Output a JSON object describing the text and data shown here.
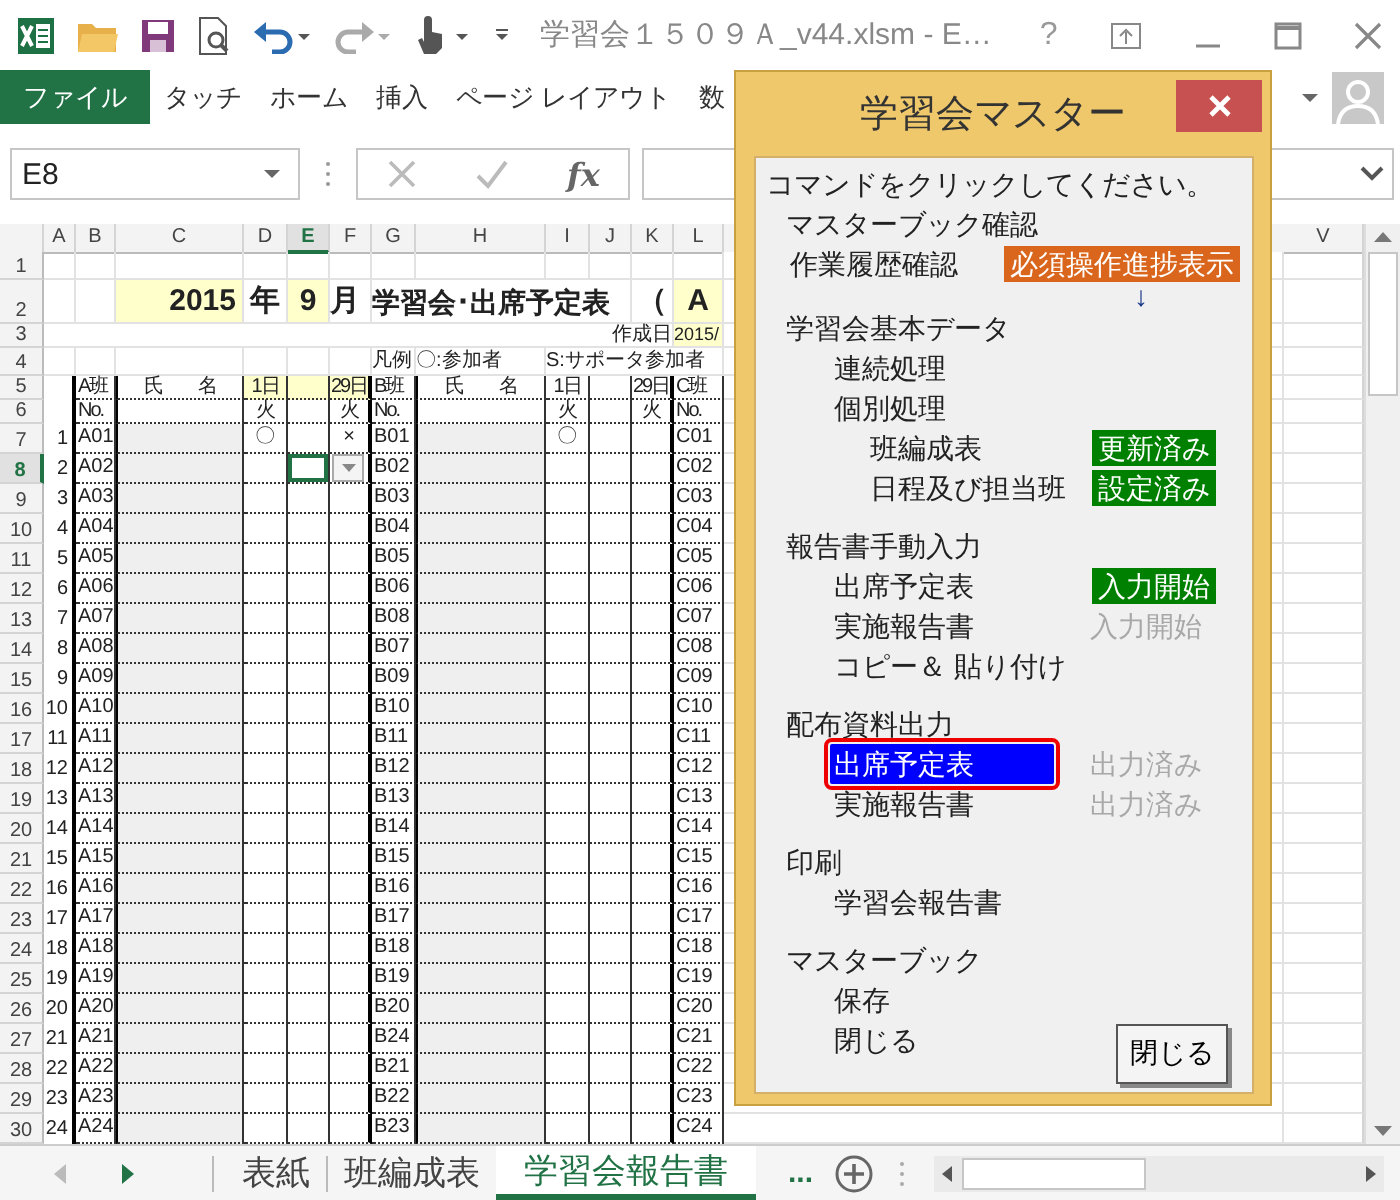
{
  "window": {
    "title": "学習会１５０９Ａ_v44.xlsm - E…",
    "help": "?"
  },
  "ribbon": {
    "tabs": [
      {
        "label": "ファイル",
        "kind": "file",
        "selected": false
      },
      {
        "label": "タッチ",
        "kind": "tab",
        "selected": false
      },
      {
        "label": "ホーム",
        "kind": "tab",
        "selected": false
      },
      {
        "label": "挿入",
        "kind": "tab",
        "selected": false
      },
      {
        "label": "ページ レイアウト",
        "kind": "tab",
        "selected": false
      },
      {
        "label": "数",
        "kind": "tab",
        "selected": false
      }
    ]
  },
  "formula_bar": {
    "name_box": "E8",
    "function_label": "fx"
  },
  "sheet": {
    "columns": [
      {
        "label": "A",
        "selected": false
      },
      {
        "label": "B",
        "selected": false
      },
      {
        "label": "C",
        "selected": false
      },
      {
        "label": "D",
        "selected": false
      },
      {
        "label": "E",
        "selected": true
      },
      {
        "label": "F",
        "selected": false
      },
      {
        "label": "G",
        "selected": false
      },
      {
        "label": "H",
        "selected": false
      },
      {
        "label": "I",
        "selected": false
      },
      {
        "label": "J",
        "selected": false
      },
      {
        "label": "K",
        "selected": false
      },
      {
        "label": "L",
        "selected": false
      },
      {
        "label": "V",
        "selected": false
      }
    ],
    "rows": [
      {
        "number": "1",
        "kind": "blank",
        "selected": false
      },
      {
        "number": "2",
        "kind": "title",
        "selected": false,
        "cells": [
          null,
          null,
          {
            "text": "2015",
            "highlight": true
          },
          {
            "text": "年"
          },
          {
            "text": "9",
            "highlight": true
          },
          {
            "text": "月"
          },
          {
            "text": "学習会･出席予定表"
          },
          null,
          null,
          null,
          {
            "text": "（"
          },
          {
            "text": "A",
            "highlight": true
          }
        ]
      },
      {
        "number": "3",
        "kind": "small",
        "selected": false,
        "cells": [
          null,
          null,
          null,
          null,
          null,
          null,
          null,
          null,
          null,
          null,
          {
            "text": "作成日"
          },
          {
            "text": "2015/",
            "highlight": true
          }
        ]
      },
      {
        "number": "4",
        "kind": "note",
        "selected": false,
        "cells": [
          null,
          null,
          null,
          null,
          null,
          null,
          {
            "text": "凡例"
          },
          {
            "text": "〇:参加者"
          },
          {
            "text": "S:サポータ参加者"
          },
          null,
          null,
          null
        ]
      },
      {
        "number": "5",
        "kind": "head",
        "selected": false,
        "cells": [
          null,
          {
            "text": "A班"
          },
          {
            "text": "氏　　名"
          },
          {
            "text": "1日",
            "highlight": true
          },
          {
            "highlight": true
          },
          {
            "text": "29日",
            "highlight": true
          },
          {
            "text": "B班"
          },
          {
            "text": "氏　　名"
          },
          {
            "text": "1日"
          },
          null,
          {
            "text": "29日"
          },
          {
            "text": "C班"
          }
        ]
      },
      {
        "number": "6",
        "kind": "head",
        "selected": false,
        "cells": [
          null,
          {
            "text": "No."
          },
          null,
          {
            "text": "火"
          },
          null,
          {
            "text": "火"
          },
          {
            "text": "No."
          },
          null,
          {
            "text": "火"
          },
          null,
          {
            "text": "火"
          },
          {
            "text": "No."
          }
        ]
      },
      {
        "number": "7",
        "kind": "data",
        "selected": false,
        "cells": [
          {
            "text": "1"
          },
          {
            "text": "A01"
          },
          null,
          {
            "text": "〇"
          },
          null,
          {
            "text": "×"
          },
          {
            "text": "B01"
          },
          null,
          {
            "text": "〇"
          },
          null,
          null,
          {
            "text": "C01"
          }
        ]
      },
      {
        "number": "8",
        "kind": "data",
        "selected": true,
        "cells": [
          {
            "text": "2"
          },
          {
            "text": "A02"
          },
          null,
          null,
          null,
          null,
          {
            "text": "B02"
          },
          null,
          null,
          null,
          null,
          {
            "text": "C02"
          }
        ]
      },
      {
        "number": "9",
        "kind": "data",
        "selected": false,
        "cells": [
          {
            "text": "3"
          },
          {
            "text": "A03"
          },
          null,
          null,
          null,
          null,
          {
            "text": "B03"
          },
          null,
          null,
          null,
          null,
          {
            "text": "C03"
          }
        ]
      },
      {
        "number": "10",
        "kind": "data",
        "selected": false,
        "cells": [
          {
            "text": "4"
          },
          {
            "text": "A04"
          },
          null,
          null,
          null,
          null,
          {
            "text": "B04"
          },
          null,
          null,
          null,
          null,
          {
            "text": "C04"
          }
        ]
      },
      {
        "number": "11",
        "kind": "data",
        "selected": false,
        "cells": [
          {
            "text": "5"
          },
          {
            "text": "A05"
          },
          null,
          null,
          null,
          null,
          {
            "text": "B05"
          },
          null,
          null,
          null,
          null,
          {
            "text": "C05"
          }
        ]
      },
      {
        "number": "12",
        "kind": "data",
        "selected": false,
        "cells": [
          {
            "text": "6"
          },
          {
            "text": "A06"
          },
          null,
          null,
          null,
          null,
          {
            "text": "B06"
          },
          null,
          null,
          null,
          null,
          {
            "text": "C06"
          }
        ]
      },
      {
        "number": "13",
        "kind": "data",
        "selected": false,
        "cells": [
          {
            "text": "7"
          },
          {
            "text": "A07"
          },
          null,
          null,
          null,
          null,
          {
            "text": "B08"
          },
          null,
          null,
          null,
          null,
          {
            "text": "C07"
          }
        ]
      },
      {
        "number": "14",
        "kind": "data",
        "selected": false,
        "cells": [
          {
            "text": "8"
          },
          {
            "text": "A08"
          },
          null,
          null,
          null,
          null,
          {
            "text": "B07"
          },
          null,
          null,
          null,
          null,
          {
            "text": "C08"
          }
        ]
      },
      {
        "number": "15",
        "kind": "data",
        "selected": false,
        "cells": [
          {
            "text": "9"
          },
          {
            "text": "A09"
          },
          null,
          null,
          null,
          null,
          {
            "text": "B09"
          },
          null,
          null,
          null,
          null,
          {
            "text": "C09"
          }
        ]
      },
      {
        "number": "16",
        "kind": "data",
        "selected": false,
        "cells": [
          {
            "text": "10"
          },
          {
            "text": "A10"
          },
          null,
          null,
          null,
          null,
          {
            "text": "B10"
          },
          null,
          null,
          null,
          null,
          {
            "text": "C10"
          }
        ]
      },
      {
        "number": "17",
        "kind": "data",
        "selected": false,
        "cells": [
          {
            "text": "11"
          },
          {
            "text": "A11"
          },
          null,
          null,
          null,
          null,
          {
            "text": "B11"
          },
          null,
          null,
          null,
          null,
          {
            "text": "C11"
          }
        ]
      },
      {
        "number": "18",
        "kind": "data",
        "selected": false,
        "cells": [
          {
            "text": "12"
          },
          {
            "text": "A12"
          },
          null,
          null,
          null,
          null,
          {
            "text": "B12"
          },
          null,
          null,
          null,
          null,
          {
            "text": "C12"
          }
        ]
      },
      {
        "number": "19",
        "kind": "data",
        "selected": false,
        "cells": [
          {
            "text": "13"
          },
          {
            "text": "A13"
          },
          null,
          null,
          null,
          null,
          {
            "text": "B13"
          },
          null,
          null,
          null,
          null,
          {
            "text": "C13"
          }
        ]
      },
      {
        "number": "20",
        "kind": "data",
        "selected": false,
        "cells": [
          {
            "text": "14"
          },
          {
            "text": "A14"
          },
          null,
          null,
          null,
          null,
          {
            "text": "B14"
          },
          null,
          null,
          null,
          null,
          {
            "text": "C14"
          }
        ]
      },
      {
        "number": "21",
        "kind": "data",
        "selected": false,
        "cells": [
          {
            "text": "15"
          },
          {
            "text": "A15"
          },
          null,
          null,
          null,
          null,
          {
            "text": "B15"
          },
          null,
          null,
          null,
          null,
          {
            "text": "C15"
          }
        ]
      },
      {
        "number": "22",
        "kind": "data",
        "selected": false,
        "cells": [
          {
            "text": "16"
          },
          {
            "text": "A16"
          },
          null,
          null,
          null,
          null,
          {
            "text": "B16"
          },
          null,
          null,
          null,
          null,
          {
            "text": "C16"
          }
        ]
      },
      {
        "number": "23",
        "kind": "data",
        "selected": false,
        "cells": [
          {
            "text": "17"
          },
          {
            "text": "A17"
          },
          null,
          null,
          null,
          null,
          {
            "text": "B17"
          },
          null,
          null,
          null,
          null,
          {
            "text": "C17"
          }
        ]
      },
      {
        "number": "24",
        "kind": "data",
        "selected": false,
        "cells": [
          {
            "text": "18"
          },
          {
            "text": "A18"
          },
          null,
          null,
          null,
          null,
          {
            "text": "B18"
          },
          null,
          null,
          null,
          null,
          {
            "text": "C18"
          }
        ]
      },
      {
        "number": "25",
        "kind": "data",
        "selected": false,
        "cells": [
          {
            "text": "19"
          },
          {
            "text": "A19"
          },
          null,
          null,
          null,
          null,
          {
            "text": "B19"
          },
          null,
          null,
          null,
          null,
          {
            "text": "C19"
          }
        ]
      },
      {
        "number": "26",
        "kind": "data",
        "selected": false,
        "cells": [
          {
            "text": "20"
          },
          {
            "text": "A20"
          },
          null,
          null,
          null,
          null,
          {
            "text": "B20"
          },
          null,
          null,
          null,
          null,
          {
            "text": "C20"
          }
        ]
      },
      {
        "number": "27",
        "kind": "data",
        "selected": false,
        "cells": [
          {
            "text": "21"
          },
          {
            "text": "A21"
          },
          null,
          null,
          null,
          null,
          {
            "text": "B24"
          },
          null,
          null,
          null,
          null,
          {
            "text": "C21"
          }
        ]
      },
      {
        "number": "28",
        "kind": "data",
        "selected": false,
        "cells": [
          {
            "text": "22"
          },
          {
            "text": "A22"
          },
          null,
          null,
          null,
          null,
          {
            "text": "B21"
          },
          null,
          null,
          null,
          null,
          {
            "text": "C22"
          }
        ]
      },
      {
        "number": "29",
        "kind": "data",
        "selected": false,
        "cells": [
          {
            "text": "23"
          },
          {
            "text": "A23"
          },
          null,
          null,
          null,
          null,
          {
            "text": "B22"
          },
          null,
          null,
          null,
          null,
          {
            "text": "C23"
          }
        ]
      },
      {
        "number": "30",
        "kind": "data",
        "selected": false,
        "cells": [
          {
            "text": "24"
          },
          {
            "text": "A24"
          },
          null,
          null,
          null,
          null,
          {
            "text": "B23"
          },
          null,
          null,
          null,
          null,
          {
            "text": "C24"
          }
        ]
      }
    ]
  },
  "sheet_tabs": {
    "tabs": [
      {
        "label": "表紙",
        "selected": false
      },
      {
        "label": "班編成表",
        "selected": false
      },
      {
        "label": "学習会報告書",
        "selected": true
      }
    ],
    "more": "..."
  },
  "dialog": {
    "title": "学習会マスター",
    "prompt": "コマンドをクリックしてください。",
    "button": "閉じる",
    "sections": [
      {
        "heading": "マスターブック確認",
        "items": [
          {
            "label": "作業履歴確認",
            "selected": false,
            "status": {
              "text": "必須操作進捗表示",
              "kind": "required"
            },
            "arrow": "↓"
          }
        ]
      },
      {
        "heading": "学習会基本データ",
        "items": [
          {
            "label": "連続処理",
            "selected": false
          },
          {
            "label": "個別処理",
            "selected": false,
            "children": [
              {
                "label": "班編成表",
                "selected": false,
                "status": {
                  "text": "更新済み",
                  "kind": "done"
                }
              },
              {
                "label": "日程及び担当班",
                "selected": false,
                "status": {
                  "text": "設定済み",
                  "kind": "done"
                }
              }
            ]
          }
        ]
      },
      {
        "heading": "報告書手動入力",
        "items": [
          {
            "label": "出席予定表",
            "selected": false,
            "status": {
              "text": "入力開始",
              "kind": "done"
            }
          },
          {
            "label": "実施報告書",
            "selected": false,
            "status": {
              "text": "入力開始",
              "kind": "inactive"
            }
          },
          {
            "label": "コピー＆ 貼り付け",
            "selected": false
          }
        ]
      },
      {
        "heading": "配布資料出力",
        "items": [
          {
            "label": "出席予定表",
            "selected": true,
            "status": {
              "text": "出力済み",
              "kind": "inactive"
            }
          },
          {
            "label": "実施報告書",
            "selected": false,
            "status": {
              "text": "出力済み",
              "kind": "inactive"
            }
          }
        ]
      },
      {
        "heading": "印刷",
        "items": [
          {
            "label": "学習会報告書",
            "selected": false
          }
        ]
      },
      {
        "heading": "マスターブック",
        "items": [
          {
            "label": "保存",
            "selected": false
          },
          {
            "label": "閉じる",
            "selected": false
          }
        ]
      }
    ]
  }
}
